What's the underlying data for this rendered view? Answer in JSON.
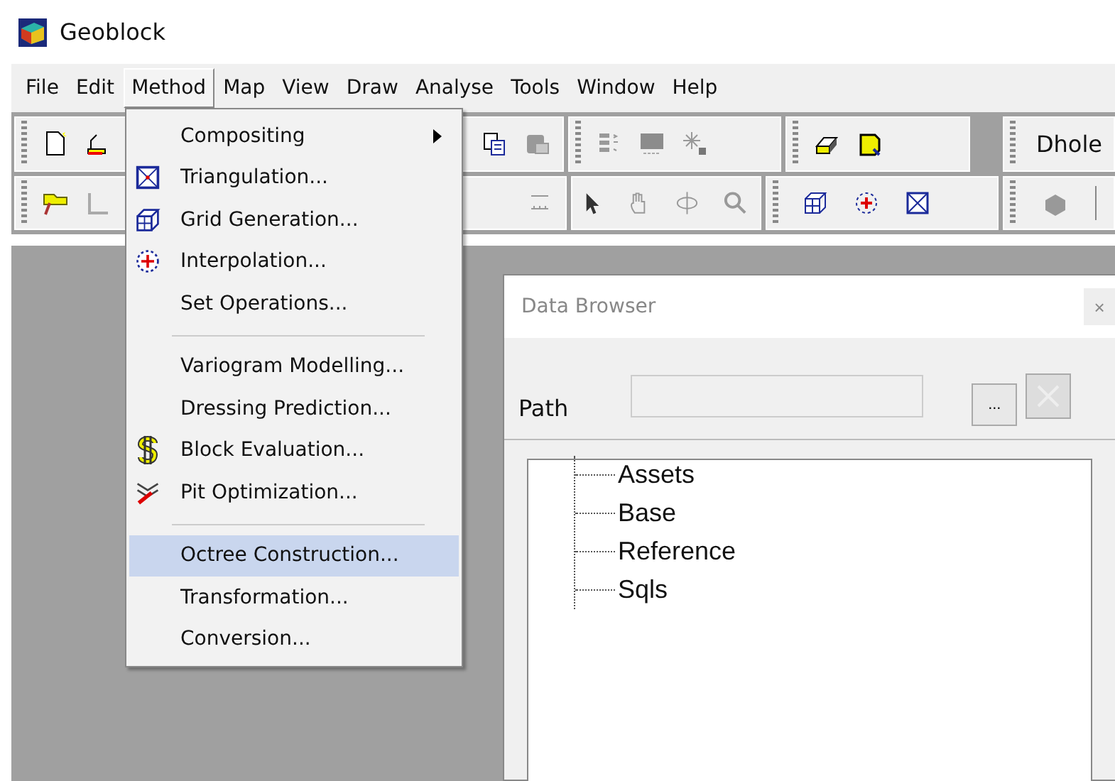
{
  "window": {
    "title": "Geoblock"
  },
  "menu_bar": [
    {
      "label": "File",
      "selected": false
    },
    {
      "label": "Edit",
      "selected": false
    },
    {
      "label": "Method",
      "selected": true
    },
    {
      "label": "Map",
      "selected": false
    },
    {
      "label": "View",
      "selected": false
    },
    {
      "label": "Draw",
      "selected": false
    },
    {
      "label": "Analyse",
      "selected": false
    },
    {
      "label": "Tools",
      "selected": false
    },
    {
      "label": "Window",
      "selected": false
    },
    {
      "label": "Help",
      "selected": false
    }
  ],
  "toolbar": {
    "combo_text": "Dhole"
  },
  "method_menu": [
    {
      "kind": "item",
      "label": "Compositing",
      "submenu": true,
      "selected": false
    },
    {
      "kind": "item",
      "label": "Triangulation...",
      "submenu": false,
      "selected": false
    },
    {
      "kind": "item",
      "label": "Grid Generation...",
      "submenu": false,
      "selected": false
    },
    {
      "kind": "item",
      "label": "Interpolation...",
      "submenu": false,
      "selected": false
    },
    {
      "kind": "item",
      "label": "Set Operations...",
      "submenu": false,
      "selected": false
    },
    {
      "kind": "separator"
    },
    {
      "kind": "item",
      "label": "Variogram Modelling...",
      "submenu": false,
      "selected": false
    },
    {
      "kind": "item",
      "label": "Dressing Prediction...",
      "submenu": false,
      "selected": false
    },
    {
      "kind": "item",
      "label": "Block Evaluation...",
      "submenu": false,
      "selected": false
    },
    {
      "kind": "item",
      "label": "Pit Optimization...",
      "submenu": false,
      "selected": false
    },
    {
      "kind": "separator"
    },
    {
      "kind": "item",
      "label": "Octree Construction...",
      "submenu": false,
      "selected": true
    },
    {
      "kind": "item",
      "label": "Transformation...",
      "submenu": false,
      "selected": false
    },
    {
      "kind": "item",
      "label": "Conversion...",
      "submenu": false,
      "selected": false
    }
  ],
  "data_browser": {
    "title": "Data Browser",
    "close": "×",
    "path_label": "Path",
    "browse_button": "...",
    "clear_disabled": true,
    "tree": [
      {
        "label": "Assets"
      },
      {
        "label": "Base"
      },
      {
        "label": "Reference"
      },
      {
        "label": "Sqls"
      }
    ]
  }
}
